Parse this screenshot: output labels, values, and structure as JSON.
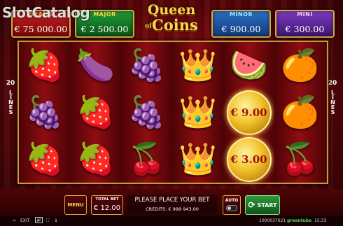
{
  "watermark": "SlotCatalog",
  "jackpots": {
    "grand": {
      "label": "GRAND",
      "value": "€ 75 000.00"
    },
    "major": {
      "label": "MAJOR",
      "value": "€ 2 500.00"
    },
    "minor": {
      "label": "MINOR",
      "value": "€ 900.00"
    },
    "mini": {
      "label": "MINI",
      "value": "€ 300.00"
    }
  },
  "logo": {
    "line1": "Queen",
    "of": "of",
    "line2": "Coins"
  },
  "lines": {
    "count": "20",
    "word": "LINES"
  },
  "reels": [
    {
      "symbols": [
        "strawberry",
        "grapes",
        "strawberry"
      ]
    },
    {
      "symbols": [
        "plum",
        "strawberry",
        "strawberry"
      ]
    },
    {
      "symbols": [
        "grapes",
        "grapes",
        "cherries"
      ]
    },
    {
      "symbols": [
        "jester-crown",
        "jester-crown",
        "jester-crown"
      ]
    },
    {
      "symbols": [
        "watermelon",
        "coin",
        "coin"
      ]
    },
    {
      "symbols": [
        "orange",
        "orange",
        "cherries"
      ]
    }
  ],
  "coin_values": [
    "€ 9.00",
    "€ 3.00"
  ],
  "controls": {
    "menu": "MENU",
    "total_bet_label": "TOTAL BET",
    "total_bet_value": "€ 12.00",
    "message": "PLEASE PLACE YOUR BET",
    "credits": "CREDITS: € 999 943.00",
    "auto": "AUTO",
    "start": "START"
  },
  "footer": {
    "exit": "EXIT",
    "round_id": "1000037621",
    "brand": "greentube",
    "time": "15:33"
  }
}
